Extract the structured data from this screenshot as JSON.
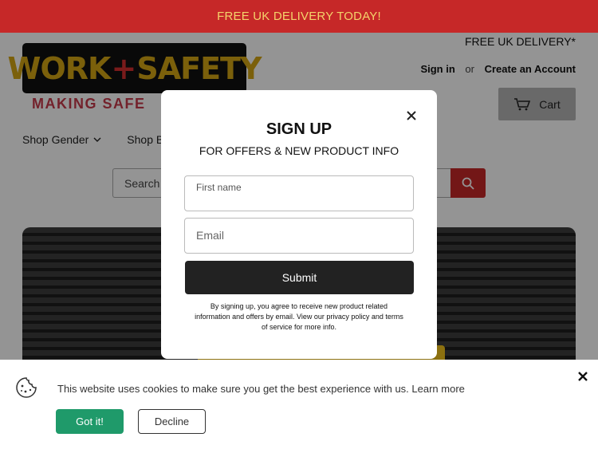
{
  "announcement": "FREE UK DELIVERY TODAY!",
  "header": {
    "delivery": "FREE UK DELIVERY*",
    "sign_in": "Sign in",
    "or": "or",
    "create_account": "Create an Account",
    "cart": "Cart"
  },
  "logo": {
    "word1": "WORK",
    "plus": "+",
    "word2": "SAFETY",
    "tagline": "MAKING SAFE"
  },
  "nav": {
    "items": [
      {
        "label": "Shop Gender"
      },
      {
        "label": "Shop B"
      }
    ]
  },
  "search": {
    "placeholder": "Search"
  },
  "modal": {
    "title": "SIGN UP",
    "subtitle": "FOR OFFERS & NEW PRODUCT INFO",
    "first_name_label": "First name",
    "email_placeholder": "Email",
    "submit": "Submit",
    "legal": "By signing up, you agree to receive new product related information and offers by email. View our privacy policy and terms of service for more info."
  },
  "cookie": {
    "text": "This website uses cookies to make sure you get the best experience with us. Learn more",
    "accept": "Got it!",
    "decline": "Decline"
  },
  "colors": {
    "announcement_bg": "#c62828",
    "announcement_text": "#f4d36b",
    "accept_button": "#1f9a6a",
    "submit_button": "#222222"
  },
  "icons": [
    "cart-icon",
    "chevron-down-icon",
    "search-icon",
    "close-icon",
    "cookie-icon"
  ]
}
